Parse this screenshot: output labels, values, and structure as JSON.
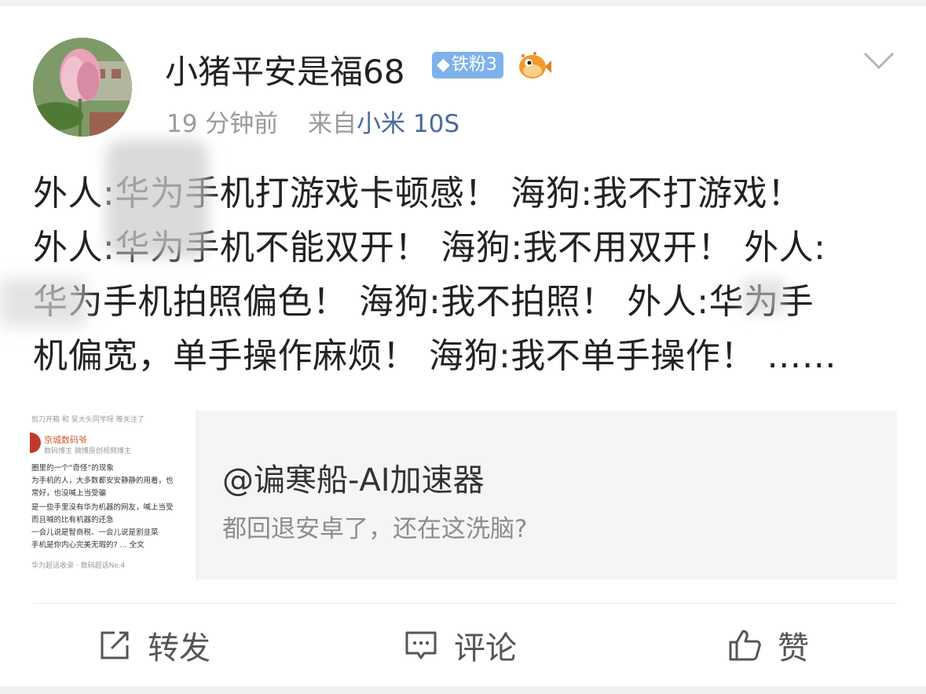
{
  "post": {
    "username": "小猪平安是福68",
    "fan_badge": "铁粉3",
    "time": "19 分钟前",
    "source_prefix": "来自",
    "device": "小米 10S",
    "lines": [
      "外人:华为手机打游戏卡顿感！  海狗:我不打游戏！",
      "外人:华为手机不能双开！  海狗:我不用双开！  外人:",
      "华为手机拍照偏色！  海狗:我不拍照！  外人:华为手",
      "机偏宽，单手操作麻烦！  海狗:我不单手操作！  ……"
    ]
  },
  "card": {
    "title": "@谝寒船-AI加速器",
    "subtitle": "都回退安卓了，还在这洗脑?",
    "thumb_lines": [
      "剪刀开箱 和 吴大头同学呀 等关注了",
      "京城数码爷",
      "数码博主 微博原创视频博主",
      "圈里的一个“奇怪”的现象",
      "为手机的人，大多数都安安静静的用着，也",
      "常好，也没喊上当受骗",
      "是一些手里没有华为机器的网友，喊上当受",
      "而且喊的比有机器的还急",
      "一会儿说是智商税、一会儿说是割韭菜",
      "手机是你内心完美无瑕的? ... 全文",
      "华为超话收录 · 数码超话No.4"
    ]
  },
  "actions": {
    "repost": "转发",
    "comment": "评论",
    "like": "赞"
  },
  "colors": {
    "badge": "#7fb2ea",
    "device_link": "#4a6b9a",
    "text": "#222222",
    "meta": "#9a9a9a"
  }
}
